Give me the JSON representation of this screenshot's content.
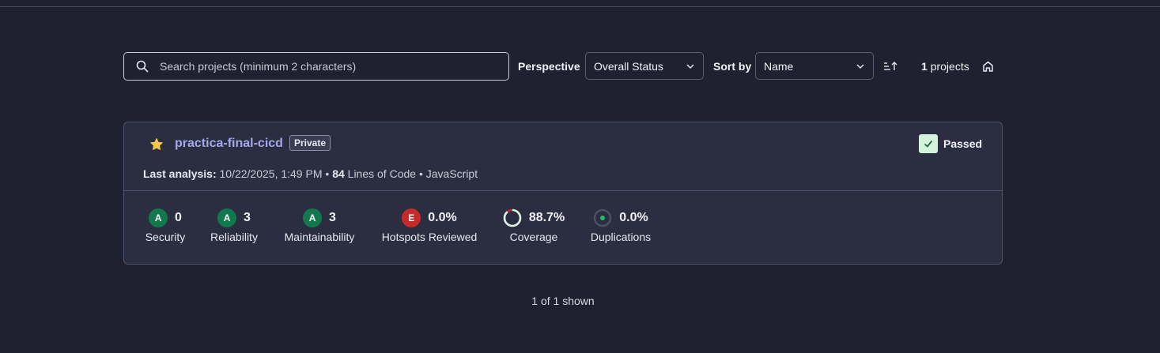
{
  "search": {
    "placeholder": "Search projects (minimum 2 characters)"
  },
  "perspective": {
    "label": "Perspective",
    "value": "Overall Status"
  },
  "sort": {
    "label": "Sort by",
    "value": "Name"
  },
  "count": {
    "number": "1",
    "label": "projects"
  },
  "project": {
    "name": "practica-final-cicd",
    "visibility": "Private",
    "status": "Passed",
    "meta": {
      "analysis_label": "Last analysis:",
      "analysis_date": "10/22/2025, 1:49 PM",
      "separator": "•",
      "lines": "84",
      "lines_label": "Lines of Code",
      "language": "JavaScript"
    },
    "metrics": {
      "security": {
        "rating": "A",
        "value": "0",
        "label": "Security"
      },
      "reliability": {
        "rating": "A",
        "value": "3",
        "label": "Reliability"
      },
      "maintainability": {
        "rating": "A",
        "value": "3",
        "label": "Maintainability"
      },
      "hotspots": {
        "rating": "E",
        "value": "0.0%",
        "label": "Hotspots Reviewed"
      },
      "coverage": {
        "value": "88.7%",
        "label": "Coverage",
        "percent": 88.7
      },
      "duplications": {
        "value": "0.0%",
        "label": "Duplications",
        "percent": 0.0
      }
    }
  },
  "footer": {
    "shown": "1 of 1 shown"
  },
  "colors": {
    "rating_a": "#13794c",
    "rating_e": "#c52b28",
    "link": "#a5a8e8",
    "passed_bg": "#d4f3dc",
    "star": "#f5c84b"
  },
  "icons": [
    "search-icon",
    "chevron-down-icon",
    "sort-ascending-icon",
    "home-icon",
    "star-icon",
    "check-icon"
  ]
}
